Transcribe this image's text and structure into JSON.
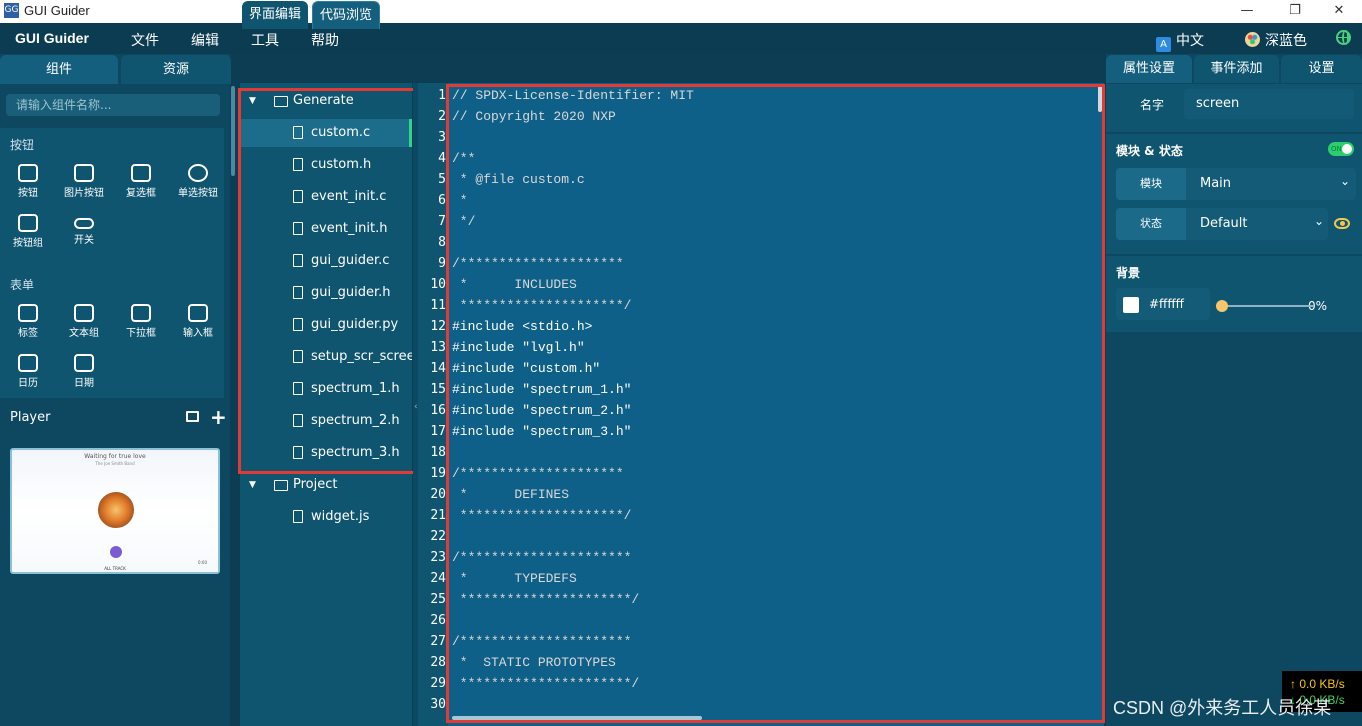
{
  "window": {
    "title": "GUI Guider",
    "min": "—",
    "restore": "❐",
    "close": "✕"
  },
  "menubar": {
    "brand": "GUI Guider",
    "items": [
      "文件",
      "编辑",
      "工具",
      "帮助"
    ],
    "language": "中文",
    "language_icon": "A",
    "theme": "深蓝色"
  },
  "left": {
    "tabs": [
      "组件",
      "资源"
    ],
    "search_placeholder": "请输入组件名称...",
    "sections": [
      {
        "title": "按钮",
        "items": [
          "按钮",
          "图片按钮",
          "复选框",
          "单选按钮",
          "按钮组",
          "开关"
        ]
      },
      {
        "title": "表单",
        "items": [
          "标签",
          "文本组",
          "下拉框",
          "输入框",
          "日历",
          "日期"
        ]
      }
    ],
    "player": {
      "name": "Player",
      "thumb": {
        "title": "Waiting for true love",
        "subtitle": "The Joe Smith Band",
        "footer": "ALL TRACK",
        "time": "0:00"
      }
    }
  },
  "view_tabs": [
    "界面编辑",
    "代码浏览"
  ],
  "tree": {
    "generate_folder": "Generate",
    "generate_files": [
      "custom.c",
      "custom.h",
      "event_init.c",
      "event_init.h",
      "gui_guider.c",
      "gui_guider.h",
      "gui_guider.py",
      "setup_scr_screen",
      "spectrum_1.h",
      "spectrum_2.h",
      "spectrum_3.h"
    ],
    "selected": "custom.c",
    "project_folder": "Project",
    "project_files": [
      "widget.js"
    ]
  },
  "code": {
    "lines": [
      "// SPDX-License-Identifier: MIT",
      "// Copyright 2020 NXP",
      "",
      "/**",
      " * @file custom.c",
      " *",
      " */",
      "",
      "/*********************",
      " *      INCLUDES",
      " *********************/",
      "#include <stdio.h>",
      "#include \"lvgl.h\"",
      "#include \"custom.h\"",
      "#include \"spectrum_1.h\"",
      "#include \"spectrum_2.h\"",
      "#include \"spectrum_3.h\"",
      "",
      "/*********************",
      " *      DEFINES",
      " *********************/",
      "",
      "/**********************",
      " *      TYPEDEFS",
      " **********************/",
      "",
      "/**********************",
      " *  STATIC PROTOTYPES",
      " **********************/",
      "",
      "/**********************"
    ]
  },
  "right": {
    "tabs": [
      "属性设置",
      "事件添加",
      "设置"
    ],
    "name_label": "名字",
    "name_value": "screen",
    "module_state_title": "模块 & 状态",
    "toggle_text": "ON",
    "module_label": "模块",
    "module_value": "Main",
    "state_label": "状态",
    "state_value": "Default",
    "background_title": "背景",
    "bg_color": "#ffffff",
    "bg_opacity": "0%"
  },
  "status": {
    "up": "↑ 0.0 KB/s",
    "down": "↓ 0.0 KB/s"
  },
  "watermark": "CSDN @外来务工人员徐某"
}
